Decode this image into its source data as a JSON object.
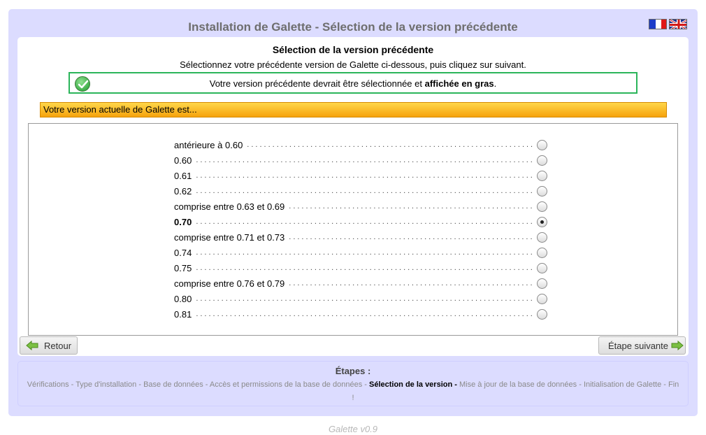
{
  "title": "Installation de Galette - Sélection de la version précédente",
  "languages": [
    {
      "name": "French",
      "icon": "flag-fr-icon"
    },
    {
      "name": "English",
      "icon": "flag-gb-icon"
    }
  ],
  "content": {
    "heading": "Sélection de la version précédente",
    "intro": "Sélectionnez votre précédente version de Galette ci-dessous, puis cliquez sur suivant.",
    "notice": {
      "text_before": "Votre version précédente devrait être sélectionnée et ",
      "text_bold": "affichée en gras",
      "text_after": ".",
      "icon": "check-icon"
    },
    "fieldset_legend": "Votre version actuelle de Galette est...",
    "versions": [
      {
        "label": "antérieure à 0.60",
        "selected": false
      },
      {
        "label": "0.60",
        "selected": false
      },
      {
        "label": "0.61",
        "selected": false
      },
      {
        "label": "0.62",
        "selected": false
      },
      {
        "label": "comprise entre 0.63 et 0.69",
        "selected": false
      },
      {
        "label": "0.70",
        "selected": true
      },
      {
        "label": "comprise entre 0.71 et 0.73",
        "selected": false
      },
      {
        "label": "0.74",
        "selected": false
      },
      {
        "label": "0.75",
        "selected": false
      },
      {
        "label": "comprise entre 0.76 et 0.79",
        "selected": false
      },
      {
        "label": "0.80",
        "selected": false
      },
      {
        "label": "0.81",
        "selected": false
      }
    ]
  },
  "buttons": {
    "back_label": "Retour",
    "next_label": "Étape suivante"
  },
  "steps": {
    "title": "Étapes :",
    "items": [
      {
        "label": "Vérifications",
        "current": false
      },
      {
        "label": "Type d'installation",
        "current": false
      },
      {
        "label": "Base de données",
        "current": false
      },
      {
        "label": "Accès et permissions de la base de données",
        "current": false
      },
      {
        "label": "Sélection de la version",
        "current": true
      },
      {
        "label": "Mise à jour de la base de données",
        "current": false
      },
      {
        "label": "Initialisation de Galette",
        "current": false
      },
      {
        "label": "Fin !",
        "current": false
      }
    ]
  },
  "footer": "Galette v0.9",
  "colors": {
    "outer_bg": "#dcdcff",
    "notice_border": "#2bb55a",
    "legend_bg_top": "#ffd74a",
    "legend_bg_bottom": "#f6a20c",
    "arrow_green": "#7bc043"
  }
}
